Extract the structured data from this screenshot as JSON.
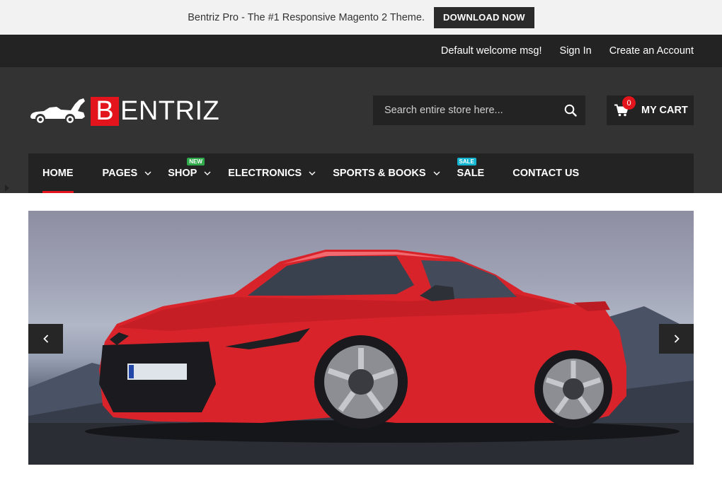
{
  "promo": {
    "text": "Bentriz Pro - The #1 Responsive Magento 2 Theme.",
    "button": "DOWNLOAD NOW"
  },
  "toplinks": {
    "welcome": "Default welcome msg!",
    "signin": "Sign In",
    "create": "Create an Account"
  },
  "logo": {
    "initial": "B",
    "rest": "ENTRIZ"
  },
  "search": {
    "placeholder": "Search entire store here..."
  },
  "cart": {
    "count": "0",
    "label": "MY CART"
  },
  "nav": {
    "items": [
      {
        "label": "HOME"
      },
      {
        "label": "PAGES"
      },
      {
        "label": "SHOP",
        "badge": "NEW"
      },
      {
        "label": "ELECTRONICS"
      },
      {
        "label": "SPORTS & BOOKS"
      },
      {
        "label": "SALE",
        "badge": "SALE"
      },
      {
        "label": "CONTACT US"
      }
    ]
  },
  "colors": {
    "accent": "#e3141b",
    "dark": "#232323",
    "header": "#333333",
    "new_badge": "#2eaa4a",
    "sale_badge": "#13b5d1",
    "car_body": "#d9232b"
  },
  "slider": {
    "image": "red-sports-coupe-photo",
    "prev_icon": "chevron-left-icon",
    "next_icon": "chevron-right-icon"
  }
}
